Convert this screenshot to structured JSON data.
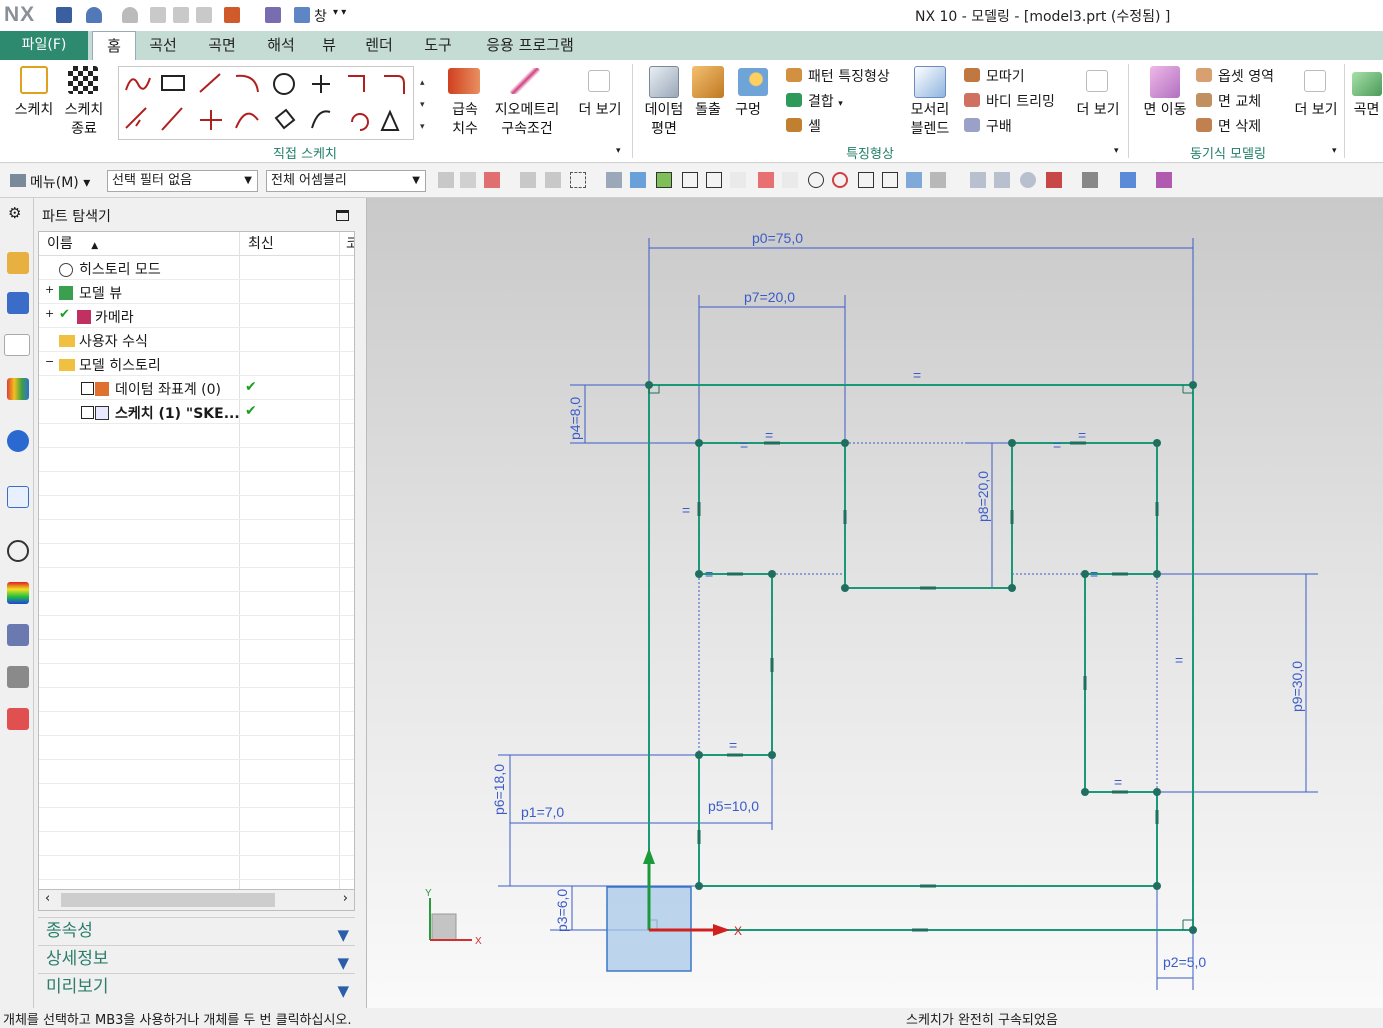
{
  "window": {
    "logo": "NX",
    "title": "NX 10 - 모델링 - [model3.prt (수정됨) ]",
    "quick_window": "창"
  },
  "tabs": {
    "file": "파일(F)",
    "items": [
      "홈",
      "곡선",
      "곡면",
      "해석",
      "뷰",
      "렌더",
      "도구",
      "응용 프로그램"
    ],
    "active": "홈"
  },
  "ribbon": {
    "sketch": "스케치",
    "sketch_finish_1": "스케치",
    "sketch_finish_2": "종료",
    "rapid_dim_1": "급속",
    "rapid_dim_2": "치수",
    "geom_con_1": "지오메트리",
    "geom_con_2": "구속조건",
    "more1": "더 보기",
    "group_direct_sketch": "직접 스케치",
    "datum_1": "데이텀",
    "datum_2": "평면",
    "extrude": "돌출",
    "hole": "구멍",
    "pattern_feature": "패턴 특징형상",
    "unite": "결합",
    "shell": "셸",
    "edge_blend_1": "모서리",
    "edge_blend_2": "블렌드",
    "chamfer": "모따기",
    "trim_body": "바디 트리밍",
    "draft": "구배",
    "more2": "더 보기",
    "group_feature": "특징형상",
    "move_face": "면 이동",
    "offset_region": "옵셋 영역",
    "replace_face": "면 교체",
    "delete_face": "면 삭제",
    "more3": "더 보기",
    "group_sync": "동기식 모델링",
    "surface": "곡면"
  },
  "filterbar": {
    "menu": "메뉴(M)",
    "selection_filter": "선택 필터 없음",
    "assembly_scope": "전체 어셈블리"
  },
  "navigator": {
    "title": "파트 탐색기",
    "col_name": "이름",
    "col_latest": "최신",
    "col_extra": "코",
    "rows": [
      {
        "label": "히스토리 모드",
        "check": ""
      },
      {
        "label": "모델 뷰",
        "check": ""
      },
      {
        "label": "카메라",
        "check": ""
      },
      {
        "label": "사용자 수식",
        "check": ""
      },
      {
        "label": "모델 히스토리",
        "check": ""
      },
      {
        "label": "데이텀 좌표계 (0)",
        "check": "✔"
      },
      {
        "label": "스케치 (1) \"SKE...",
        "check": "✔"
      }
    ],
    "panels": [
      "종속성",
      "상세정보",
      "미리보기"
    ]
  },
  "dimensions": {
    "p0": "p0=75,0",
    "p7": "p7=20,0",
    "p4": "p4=8,0",
    "p8": "p8=20,0",
    "p9": "p9=30,0",
    "p6": "p6=18,0",
    "p1": "p1=7,0",
    "p5": "p5=10,0",
    "p3": "p3=6,0",
    "p2": "p2=5,0"
  },
  "triad": {
    "x": "X",
    "y": "Y",
    "x_small": "X",
    "y_small": "Y"
  },
  "status": {
    "left": "개체를 선택하고 MB3을 사용하거나 개체를 두 번 클릭하십시오.",
    "right": "스케치가 완전히 구속되었음"
  },
  "colors": {
    "sketch_line": "#1a9878",
    "dimension": "#3b5cc8",
    "accent": "#2e8a6e",
    "canvas_top": "#c9c9c9"
  }
}
